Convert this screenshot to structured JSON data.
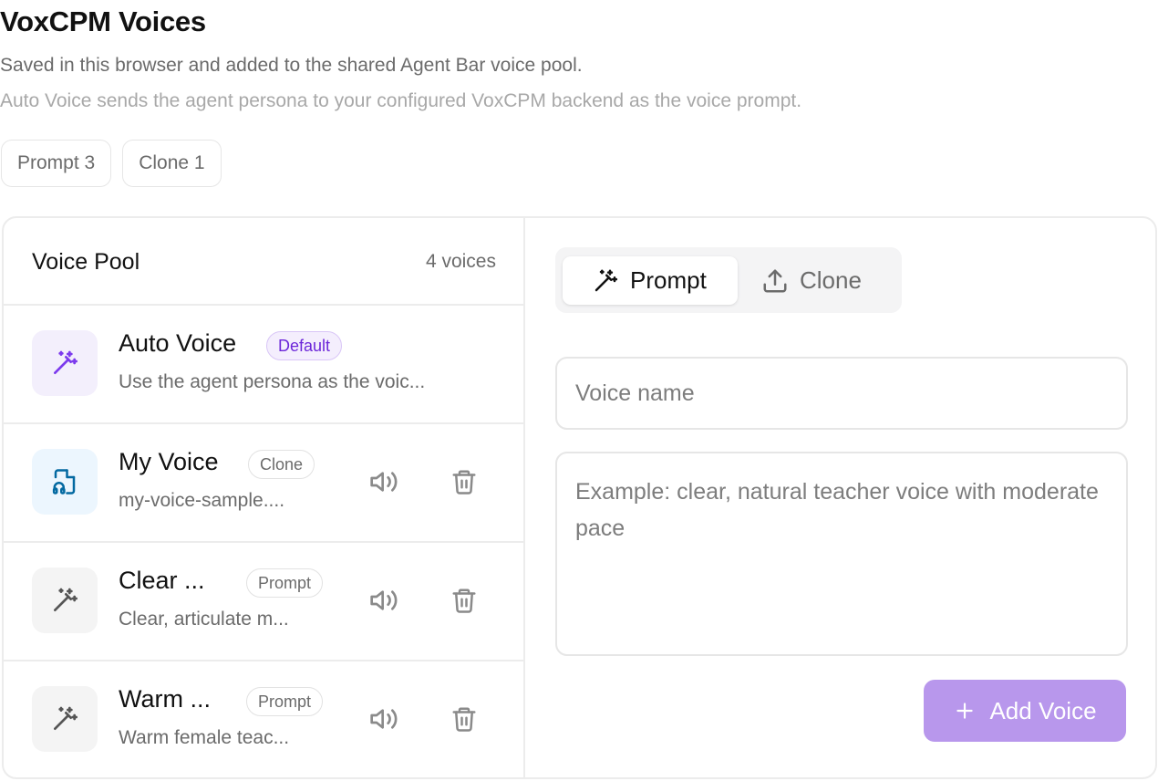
{
  "header": {
    "title": "VoxCPM Voices",
    "subtitle": "Saved in this browser and added to the shared Agent Bar voice pool.",
    "hint": "Auto Voice sends the agent persona to your configured VoxCPM backend as the voice prompt."
  },
  "filters": [
    {
      "label": "Prompt 3"
    },
    {
      "label": "Clone 1"
    }
  ],
  "pool": {
    "title": "Voice Pool",
    "count": "4 voices",
    "voices": [
      {
        "name": "Auto Voice",
        "badge": "Default",
        "description": "Use the agent persona as the voic...",
        "icon": "magic-wand-icon"
      },
      {
        "name": "My Voice",
        "badge": "Clone",
        "description": "my-voice-sample....",
        "icon": "audio-file-icon"
      },
      {
        "name": "Clear ...",
        "badge": "Prompt",
        "description": "Clear, articulate m...",
        "icon": "magic-wand-icon"
      },
      {
        "name": "Warm ...",
        "badge": "Prompt",
        "description": "Warm female teac...",
        "icon": "magic-wand-icon"
      }
    ]
  },
  "editor": {
    "tabs": [
      {
        "label": "Prompt",
        "icon": "magic-wand-icon",
        "active": true
      },
      {
        "label": "Clone",
        "icon": "upload-icon",
        "active": false
      }
    ],
    "name_placeholder": "Voice name",
    "name_value": "",
    "prompt_placeholder": "Example: clear, natural teacher voice with moderate pace",
    "prompt_value": "",
    "add_button": "Add Voice"
  },
  "colors": {
    "accent": "#7c3aed",
    "accent_disabled": "#b897ec",
    "clone_accent": "#0369a1"
  }
}
